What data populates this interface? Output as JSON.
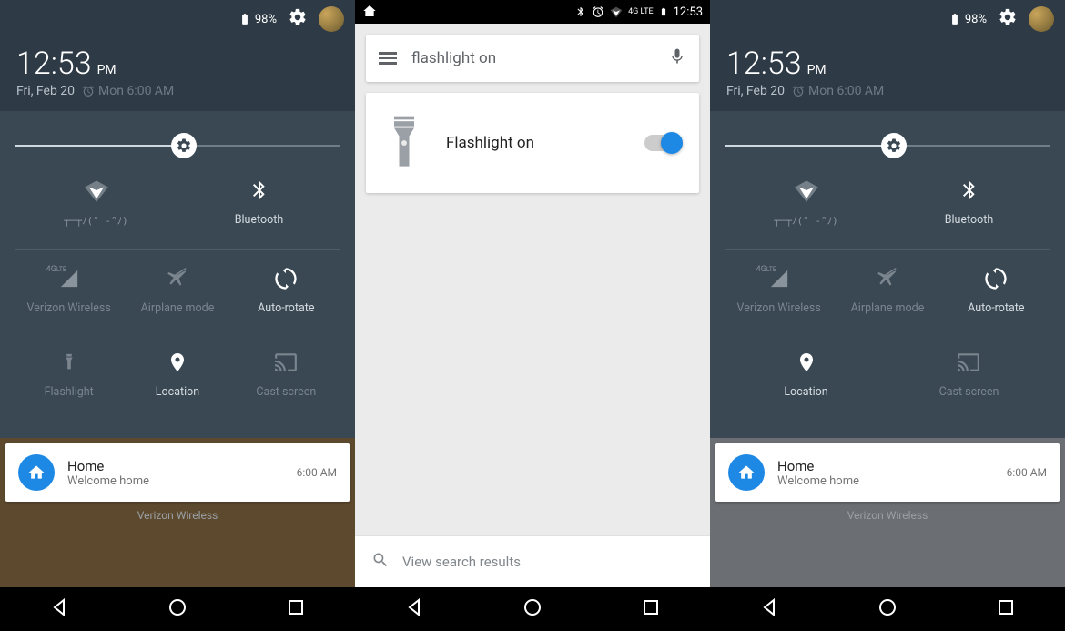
{
  "left": {
    "status": {
      "battery": "98%"
    },
    "clock": {
      "time": "12:53",
      "ampm": "PM",
      "date": "Fri, Feb 20",
      "alarm": "Mon 6:00 AM"
    },
    "brightness_pct": 52,
    "tiles": {
      "wifi": "┬─┬ﾉ(° -°ﾉ)",
      "bluetooth": "Bluetooth",
      "cellular": "Verizon Wireless",
      "airplane": "Airplane mode",
      "rotate": "Auto-rotate",
      "flashlight": "Flashlight",
      "location": "Location",
      "cast": "Cast screen"
    },
    "notification": {
      "title": "Home",
      "subtitle": "Welcome home",
      "time": "6:00 AM"
    },
    "carrier": "Verizon Wireless"
  },
  "center": {
    "status": {
      "network": "4G LTE",
      "time": "12:53"
    },
    "search_query": "flashlight on",
    "card_label": "Flashlight on",
    "switch_on": true,
    "bottom_search": "View search results"
  },
  "right": {
    "status": {
      "battery": "98%"
    },
    "clock": {
      "time": "12:53",
      "ampm": "PM",
      "date": "Fri, Feb 20",
      "alarm": "Mon 6:00 AM"
    },
    "brightness_pct": 52,
    "tiles": {
      "wifi": "┬─┬ﾉ(° -°ﾉ)",
      "bluetooth": "Bluetooth",
      "cellular": "Verizon Wireless",
      "airplane": "Airplane mode",
      "rotate": "Auto-rotate",
      "location": "Location",
      "cast": "Cast screen"
    },
    "notification": {
      "title": "Home",
      "subtitle": "Welcome home",
      "time": "6:00 AM"
    },
    "carrier": "Verizon Wireless"
  }
}
